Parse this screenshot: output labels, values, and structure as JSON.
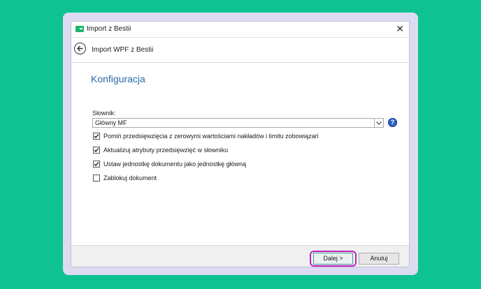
{
  "window": {
    "title": "Import z Bestii"
  },
  "nav": {
    "title": "Import WPF z Bestii"
  },
  "section": {
    "heading": "Konfiguracja"
  },
  "dictionary": {
    "label": "Słownik:",
    "value": "Główny MF",
    "help": "?"
  },
  "options": [
    {
      "label": "Pomiń przedsięwzięcia z zerowymi wartościami nakładów i limitu zobowiązań",
      "checked": true
    },
    {
      "label": "Aktualizuj atrybuty przedsięwzięć w słowniku",
      "checked": true
    },
    {
      "label": "Ustaw jednostkę dokumentu jako jednostkę główną",
      "checked": true
    },
    {
      "label": "Zablokuj dokument",
      "checked": false
    }
  ],
  "footer": {
    "next_label": "Dalej >",
    "cancel_label": "Anuluj"
  },
  "colors": {
    "background": "#0ec292",
    "accent": "#2b6aa8",
    "highlight": "#c020c0",
    "app_icon": "#1eb56e"
  },
  "icons": {
    "app": "app-icon",
    "close": "close-icon",
    "back": "back-arrow-icon",
    "dropdown": "chevron-down-icon",
    "help": "help-icon"
  }
}
